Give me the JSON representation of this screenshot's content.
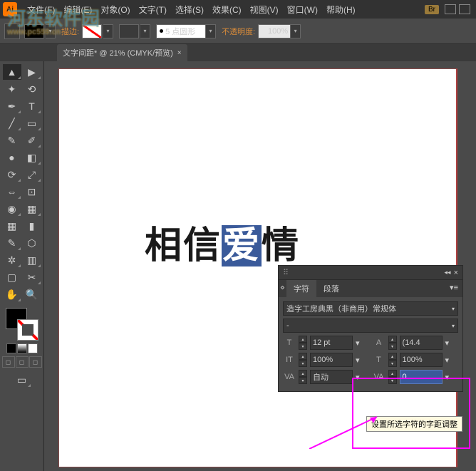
{
  "app": {
    "logo": "Ai"
  },
  "menu": {
    "file": "文件(F)",
    "edit": "编辑(E)",
    "object": "对象(O)",
    "type": "文字(T)",
    "select": "选择(S)",
    "effect": "效果(C)",
    "view": "视图(V)",
    "window": "窗口(W)",
    "help": "帮助(H)",
    "br": "Br"
  },
  "optbar": {
    "stroke_label": "描边:",
    "stroke_style": "5 点圆形",
    "opacity_label": "不透明度:",
    "opacity_value": "100%"
  },
  "tab": {
    "title": "文字间距* @ 21% (CMYK/预览)",
    "close": "×"
  },
  "artwork": {
    "text_a": "相信",
    "text_hl": "爱",
    "text_b": "情"
  },
  "char_panel": {
    "tab_char": "字符",
    "tab_para": "段落",
    "font_family": "造字工房典黑（非商用）常规体",
    "font_style": "-",
    "size_label": "T",
    "size_value": "12 pt",
    "leading_label": "A",
    "leading_value": "(14.4",
    "hscale_label": "IT",
    "hscale_value": "100%",
    "vscale_label": "T",
    "vscale_value": "100%",
    "kerning_label": "VA",
    "kerning_value": "自动",
    "tracking_label": "VA",
    "tracking_value": "0"
  },
  "tooltip": {
    "text": "设置所选字符的字距调整"
  },
  "watermark": {
    "main": "河东软件园",
    "sub": "www.pc559.cn"
  }
}
